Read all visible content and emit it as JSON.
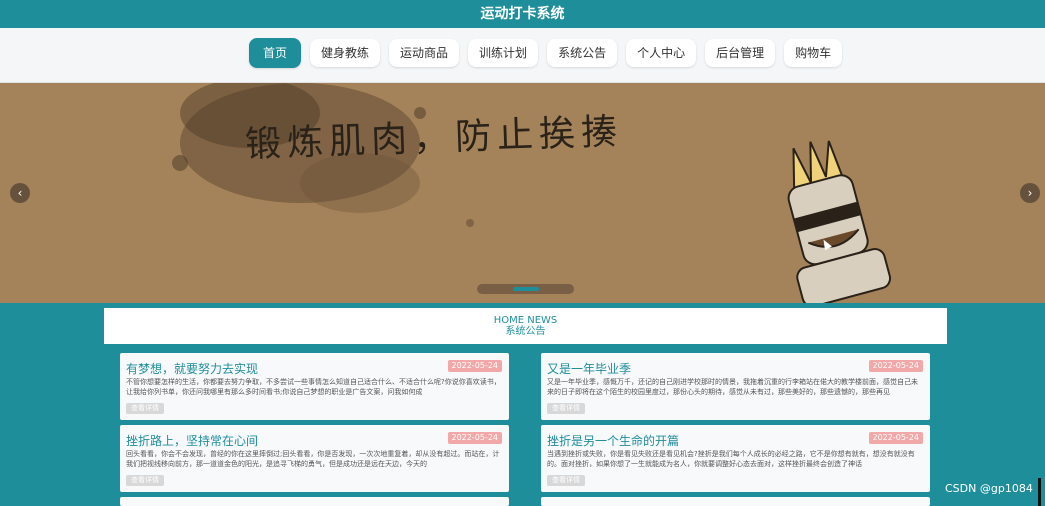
{
  "app": {
    "title": "运动打卡系统"
  },
  "nav": {
    "items": [
      {
        "label": "首页"
      },
      {
        "label": "健身教练"
      },
      {
        "label": "运动商品"
      },
      {
        "label": "训练计划"
      },
      {
        "label": "系统公告"
      },
      {
        "label": "个人中心"
      },
      {
        "label": "后台管理"
      },
      {
        "label": "购物车"
      }
    ],
    "active_index": 0
  },
  "banner": {
    "text": "锻炼肌肉，防止挨揍",
    "prev_icon": "chevron-left-icon",
    "next_icon": "chevron-right-icon",
    "prev_glyph": "‹",
    "next_glyph": "›",
    "slide_index": 2,
    "slide_count": 3
  },
  "news": {
    "header_en": "HOME NEWS",
    "header_cn": "系统公告",
    "cards": [
      {
        "title": "有梦想，就要努力去实现",
        "date": "2022-05-24",
        "excerpt": "不管你想要怎样的生活，你都要去努力争取，不多尝试一些事情怎么知道自己适合什么、不适合什么呢?你说你喜欢读书，让我给你列书单，你还问我哪里有那么多时间看书;你说自己梦想的职业是广告文案，问我如何成",
        "button": "查看详情"
      },
      {
        "title": "又是一年毕业季",
        "date": "2022-05-24",
        "excerpt": "又是一年毕业季，感慨万千，还记的自己刚进学校那时的情景，我拖着沉重的行李箱站在偌大的教学楼前面，感觉自己未来的日子即将在这个陌生的校园里度过，那份心头的期待，感觉从未有过，那些美好的，那些遗憾的，那些再见",
        "button": "查看详情"
      },
      {
        "title": "挫折路上，坚持常在心间",
        "date": "2022-05-24",
        "excerpt": "回头看看，你会不会发现，曾经的你在这里摔倒过;回头看看，你是否发现，一次次地重复着，却从没有超过。而站在，计我们把视线移向前方，那一道道金色的阳光，是追寻飞梯的勇气，但是成功还是远在天边，今天的",
        "button": "查看详情"
      },
      {
        "title": "挫折是另一个生命的开篇",
        "date": "2022-05-24",
        "excerpt": "当遇到挫折或失败，你是看见失败还是看见机会?挫折是我们每个人成长的必经之路，它不是你想有就有，想没有就没有的。面对挫折，如果你想了一生就能成为名人，你就要调整好心态去面对，这样挫折最终会创造了神话",
        "button": "查看详情"
      }
    ]
  },
  "footer": {
    "watermark": "CSDN @gp1084"
  },
  "colors": {
    "primary": "#1f8e9b",
    "date_badge": "#f2a8a8",
    "banner_bg": "#a5835a"
  }
}
